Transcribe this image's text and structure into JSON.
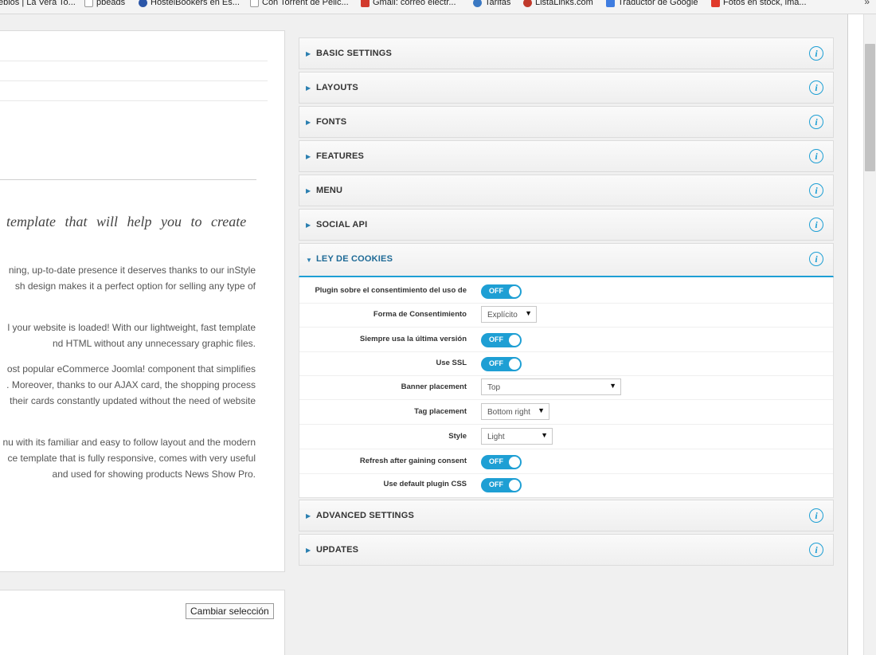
{
  "bookmarks": [
    {
      "label": "eblos | La Vera To...",
      "icon": "page-icon",
      "color": "#ffffff"
    },
    {
      "label": "pbeads",
      "icon": "page-icon",
      "color": "#ffffff"
    },
    {
      "label": "HostelBookers en Es...",
      "icon": "hostelbookers-icon",
      "color": "#2b56a8"
    },
    {
      "label": "Con Torrent de Pelic...",
      "icon": "page-icon",
      "color": "#ffffff"
    },
    {
      "label": "Gmail: correo electr...",
      "icon": "gmail-icon",
      "color": "#d23b2e"
    },
    {
      "label": "Tarifas",
      "icon": "globe-icon",
      "color": "#3a78c2"
    },
    {
      "label": "ListaLinks.com",
      "icon": "listalinks-icon",
      "color": "#c0392b"
    },
    {
      "label": "Traductor de Google",
      "icon": "google-translate-icon",
      "color": "#3f7de0"
    },
    {
      "label": "Fotos en stock, ima...",
      "icon": "stock-icon",
      "color": "#e03a2b"
    }
  ],
  "bookmarks_more": "»",
  "left": {
    "heading": "template that will help you to create",
    "paragraphs": [
      [
        "ning, up-to-date presence it deserves thanks to our inStyle",
        "sh design makes it a perfect option for selling any type of"
      ],
      [
        "l your website is loaded! With our lightweight, fast template",
        "nd HTML without any unnecessary graphic files."
      ],
      [
        "ost popular eCommerce Joomla! component that simplifies",
        ". Moreover, thanks to our AJAX card, the shopping process",
        "their cards constantly updated without the need of website"
      ],
      [
        "nu with its familiar and easy to follow layout and the modern",
        "ce template that is fully responsive, comes with very useful",
        "and used for showing products News Show Pro."
      ]
    ],
    "change_button": "Cambiar selección"
  },
  "accordion": [
    {
      "label": "BASIC SETTINGS",
      "open": false
    },
    {
      "label": "LAYOUTS",
      "open": false
    },
    {
      "label": "FONTS",
      "open": false
    },
    {
      "label": "FEATURES",
      "open": false
    },
    {
      "label": "MENU",
      "open": false
    },
    {
      "label": "SOCIAL API",
      "open": false
    },
    {
      "label": "LEY DE COOKIES",
      "open": true
    },
    {
      "label": "ADVANCED SETTINGS",
      "open": false
    },
    {
      "label": "UPDATES",
      "open": false
    }
  ],
  "info_glyph": "i",
  "cookie_settings": [
    {
      "label": "Plugin sobre el consentimiento del uso de",
      "type": "toggle",
      "value": "OFF"
    },
    {
      "label": "Forma de Consentimiento",
      "type": "select",
      "value": "Explícito"
    },
    {
      "label": "Siempre usa la última versión",
      "type": "toggle",
      "value": "OFF"
    },
    {
      "label": "Use SSL",
      "type": "toggle",
      "value": "OFF"
    },
    {
      "label": "Banner placement",
      "type": "select",
      "value": "Top"
    },
    {
      "label": "Tag placement",
      "type": "select",
      "value": "Bottom right"
    },
    {
      "label": "Style",
      "type": "select",
      "value": "Light"
    },
    {
      "label": "Refresh after gaining consent",
      "type": "toggle",
      "value": "OFF"
    },
    {
      "label": "Use default plugin CSS",
      "type": "toggle",
      "value": "OFF"
    }
  ],
  "colors": {
    "accent": "#1e9fd4",
    "open_header_text": "#1e6a96"
  }
}
